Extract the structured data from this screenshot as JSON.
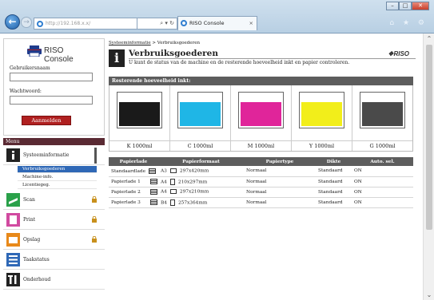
{
  "browser": {
    "address": "http://192.168.x.x/",
    "address_tools": "⌕ ▾ ↻",
    "tab_title": "RISO Console",
    "tab_close": "×",
    "right_icons": "⌂ ★ ⚙",
    "win_min": "–",
    "win_max": "□",
    "win_close": "✕"
  },
  "login": {
    "logo_text": "RISO Console",
    "username_label": "Gebruikersnaam",
    "password_label": "Wachtwoord:",
    "login_button": "Aanmelden"
  },
  "menu": {
    "header": "Menu",
    "items": [
      {
        "label": "Systeeminformatie"
      },
      {
        "label": "Scan"
      },
      {
        "label": "Print"
      },
      {
        "label": "Opslag"
      },
      {
        "label": "Taakstatus"
      },
      {
        "label": "Onderhoud"
      }
    ],
    "subitems": [
      {
        "label": "Verbruiksgoederen"
      },
      {
        "label": "Machine-info."
      },
      {
        "label": "Licentiegeg."
      }
    ]
  },
  "main": {
    "breadcrumb_link": "Systeeminformatie",
    "breadcrumb_rest": " > Verbruiksgoederen",
    "title": "Verbruiksgoederen",
    "description": "U kunt de status van de machine en de resterende hoeveelheid inkt en papier controleren.",
    "brand": "RISO"
  },
  "ink": {
    "header": "Resterende hoeveelheid inkt:",
    "cartridges": [
      {
        "label": "K 1000ml",
        "color": "#1a1a1a",
        "level": 0.78
      },
      {
        "label": "C 1000ml",
        "color": "#1fb6e6",
        "level": 0.78
      },
      {
        "label": "M 1000ml",
        "color": "#e0259a",
        "level": 0.78
      },
      {
        "label": "Y 1000ml",
        "color": "#f2ee1a",
        "level": 0.78
      },
      {
        "label": "G  1000ml",
        "color": "#4a4a4a",
        "level": 0.78
      }
    ]
  },
  "paper": {
    "headers": [
      "Papierlade",
      "Papierformaat",
      "Papiertype",
      "Dikte",
      "Auto. sel."
    ],
    "rows": [
      {
        "tray": "Standaardlade",
        "size": "A3",
        "dims": "297x420mm",
        "type": "Normaal",
        "thickness": "Standaard",
        "auto": "ON"
      },
      {
        "tray": "Papierlade 1",
        "size": "A4",
        "dims": "210x297mm",
        "type": "Normaal",
        "thickness": "Standaard",
        "auto": "ON"
      },
      {
        "tray": "Papierlade 2",
        "size": "A4",
        "dims": "297x210mm",
        "type": "Normaal",
        "thickness": "Standaard",
        "auto": "ON"
      },
      {
        "tray": "Papierlade 3",
        "size": "B4",
        "dims": "257x364mm",
        "type": "Normaal",
        "thickness": "Standaard",
        "auto": "ON"
      }
    ]
  }
}
